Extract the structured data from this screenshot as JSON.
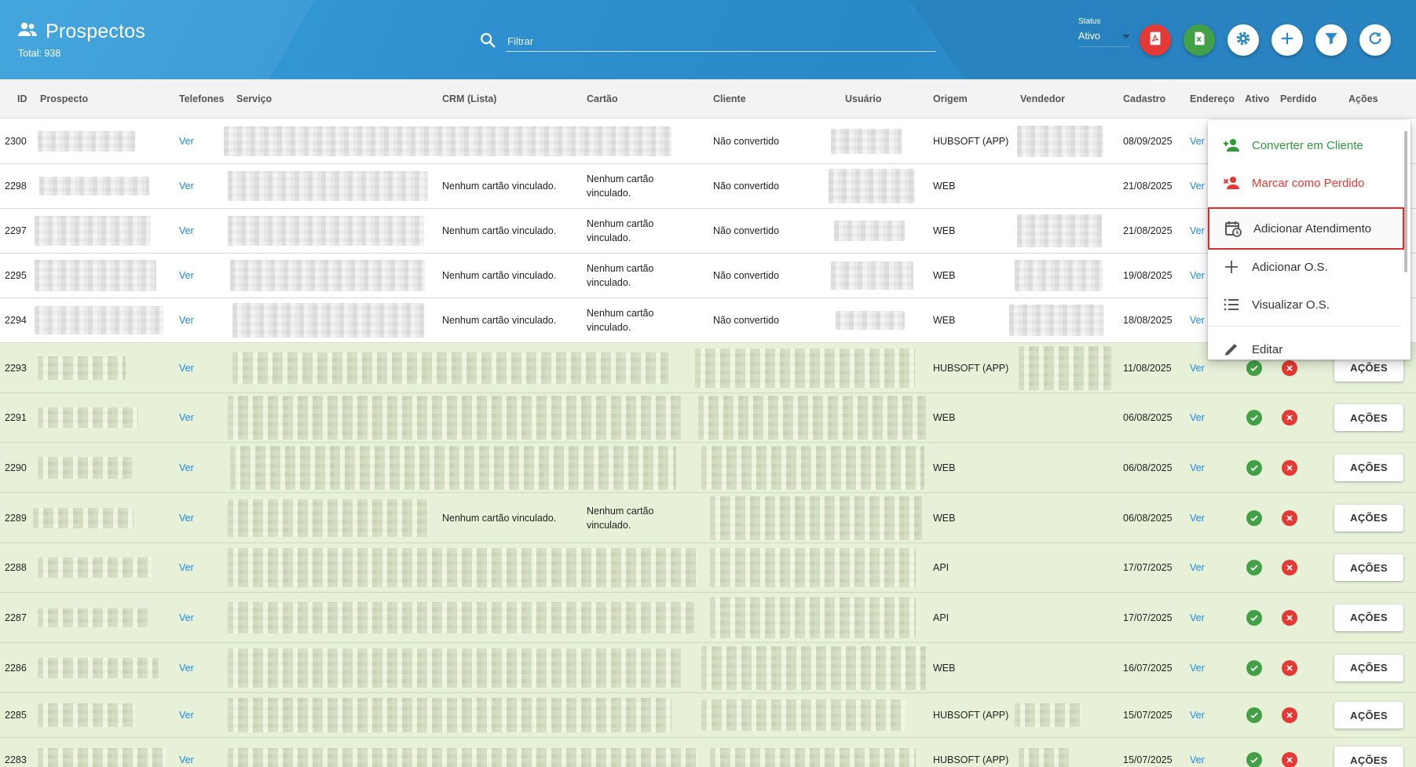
{
  "header": {
    "title": "Prospectos",
    "total": "Total: 938",
    "search_placeholder": "Filtrar",
    "status_label": "Status",
    "status_value": "Ativo",
    "buttons": [
      "pdf-icon",
      "excel-icon",
      "gear-icon",
      "plus-icon",
      "filter-icon",
      "refresh-icon"
    ]
  },
  "columns": [
    "ID",
    "Prospecto",
    "Telefones",
    "Serviço",
    "CRM (Lista)",
    "Cartão",
    "Cliente",
    "Usuário",
    "Origem",
    "Vendedor",
    "Cadastro",
    "Endereço",
    "Ativo",
    "Perdido",
    "Ações"
  ],
  "rows": [
    {
      "id": "2300",
      "telefones": "Ver",
      "crm": "",
      "cartao": "",
      "cliente": "Não convertido",
      "origem": "HUBSOFT (APP)",
      "cadastro": "08/09/2025",
      "endereco": "Ver",
      "acoes": ""
    },
    {
      "id": "2298",
      "telefones": "Ver",
      "crm": "Nenhum cartão vinculado.",
      "cartao": "Nenhum cartão vinculado.",
      "cliente": "Não convertido",
      "origem": "WEB",
      "cadastro": "21/08/2025",
      "endereco": "Ver",
      "acoes": ""
    },
    {
      "id": "2297",
      "telefones": "Ver",
      "crm": "Nenhum cartão vinculado.",
      "cartao": "Nenhum cartão vinculado.",
      "cliente": "Não convertido",
      "origem": "WEB",
      "cadastro": "21/08/2025",
      "endereco": "Ver",
      "acoes": ""
    },
    {
      "id": "2295",
      "telefones": "Ver",
      "crm": "Nenhum cartão vinculado.",
      "cartao": "Nenhum cartão vinculado.",
      "cliente": "Não convertido",
      "origem": "WEB",
      "cadastro": "19/08/2025",
      "endereco": "Ver",
      "acoes": ""
    },
    {
      "id": "2294",
      "telefones": "Ver",
      "crm": "Nenhum cartão vinculado.",
      "cartao": "Nenhum cartão vinculado.",
      "cliente": "Não convertido",
      "origem": "WEB",
      "cadastro": "18/08/2025",
      "endereco": "Ver",
      "acoes": ""
    },
    {
      "id": "2293",
      "telefones": "Ver",
      "crm": "",
      "cartao": "",
      "cliente": "",
      "origem": "HUBSOFT (APP)",
      "cadastro": "11/08/2025",
      "endereco": "Ver",
      "acoes": "AÇÕES"
    },
    {
      "id": "2291",
      "telefones": "Ver",
      "crm": "",
      "cartao": "",
      "cliente": "",
      "origem": "WEB",
      "cadastro": "06/08/2025",
      "endereco": "Ver",
      "acoes": "AÇÕES"
    },
    {
      "id": "2290",
      "telefones": "Ver",
      "crm": "",
      "cartao": "",
      "cliente": "",
      "origem": "WEB",
      "cadastro": "06/08/2025",
      "endereco": "Ver",
      "acoes": "AÇÕES"
    },
    {
      "id": "2289",
      "telefones": "Ver",
      "crm": "Nenhum cartão vinculado.",
      "cartao": "Nenhum cartão vinculado.",
      "cliente": "",
      "origem": "WEB",
      "cadastro": "06/08/2025",
      "endereco": "Ver",
      "acoes": "AÇÕES"
    },
    {
      "id": "2288",
      "telefones": "Ver",
      "crm": "",
      "cartao": "",
      "cliente": "",
      "origem": "API",
      "cadastro": "17/07/2025",
      "endereco": "Ver",
      "acoes": "AÇÕES"
    },
    {
      "id": "2287",
      "telefones": "Ver",
      "crm": "",
      "cartao": "",
      "cliente": "",
      "origem": "API",
      "cadastro": "17/07/2025",
      "endereco": "Ver",
      "acoes": "AÇÕES"
    },
    {
      "id": "2286",
      "telefones": "Ver",
      "crm": "",
      "cartao": "",
      "cliente": "",
      "origem": "WEB",
      "cadastro": "16/07/2025",
      "endereco": "Ver",
      "acoes": "AÇÕES"
    },
    {
      "id": "2285",
      "telefones": "Ver",
      "crm": "",
      "cartao": "",
      "cliente": "",
      "origem": "HUBSOFT (APP)",
      "cadastro": "15/07/2025",
      "endereco": "Ver",
      "acoes": "AÇÕES"
    },
    {
      "id": "2283",
      "telefones": "Ver",
      "crm": "",
      "cartao": "",
      "cliente": "",
      "origem": "HUBSOFT (APP)",
      "cadastro": "15/07/2025",
      "endereco": "Ver",
      "acoes": "AÇÕES"
    }
  ],
  "menu": {
    "items": [
      {
        "label": "Converter em Cliente",
        "icon": "person-add-icon",
        "color": "#2e9b3a"
      },
      {
        "label": "Marcar como Perdido",
        "icon": "person-remove-icon",
        "color": "#e53935"
      },
      {
        "label": "Adicionar Atendimento",
        "icon": "calendar-clock-icon",
        "highlighted": true
      },
      {
        "label": "Adicionar O.S.",
        "icon": "plus-icon"
      },
      {
        "label": "Visualizar O.S.",
        "icon": "list-icon"
      },
      {
        "label": "Editar",
        "icon": "pencil-icon"
      }
    ]
  },
  "colors": {
    "header": "#2f8fcf",
    "link": "#1e88e5",
    "green_row": "#e6f1d8",
    "ok": "#43a047",
    "danger": "#e53935"
  }
}
